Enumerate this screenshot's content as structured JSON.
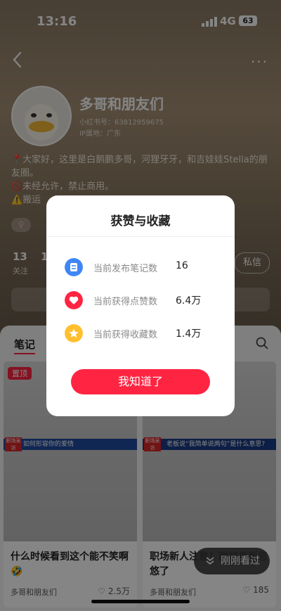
{
  "status_bar": {
    "time": "13:16",
    "network": "4G",
    "battery": "63"
  },
  "profile": {
    "name": "多哥和朋友们",
    "red_id": "小红书号：63812959675",
    "ip_location": "IP属地：广东",
    "bio": [
      "📍大家好，这里是白鹅鹏多哥，河狸牙牙，和吉娃娃Stella的朋友圈。",
      "🚫未经允许，禁止商用。",
      "⚠️搬运"
    ],
    "following_count": "13",
    "following_label": "关注",
    "follower_partial": "1",
    "message_button": "私信"
  },
  "tabs": {
    "notes": "笔记"
  },
  "cards": [
    {
      "pinned": "置顶",
      "channel_label": "职场采访",
      "banner": "如何形容你的爱情",
      "title": "什么时候看到这个能不笑啊🤣",
      "author": "多哥和朋友们",
      "likes": "2.5万"
    },
    {
      "channel_label": "职场采访",
      "banner": "老板说“我简单说两句”是什么意思?",
      "title": "职场新人注意！就被老板忽悠了",
      "author": "多哥和朋友们",
      "likes": "185"
    }
  ],
  "recently_seen": "刚刚看过",
  "modal": {
    "title": "获赞与收藏",
    "rows": [
      {
        "label": "当前发布笔记数",
        "value": "16",
        "icon": "notes-icon",
        "color": "#3f86f5"
      },
      {
        "label": "当前获得点赞数",
        "value": "6.4万",
        "icon": "heart-icon",
        "color": "#ff2442"
      },
      {
        "label": "当前获得收藏数",
        "value": "1.4万",
        "icon": "star-icon",
        "color": "#ffbf2e"
      }
    ],
    "confirm": "我知道了"
  }
}
